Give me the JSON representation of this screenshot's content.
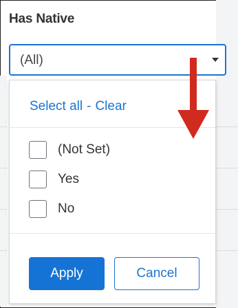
{
  "filter": {
    "title": "Has Native",
    "selected_value": "(All)"
  },
  "dropdown": {
    "select_all_label": "Select all",
    "separator": "-",
    "clear_label": "Clear",
    "options": [
      {
        "label": "(Not Set)",
        "checked": false
      },
      {
        "label": "Yes",
        "checked": false
      },
      {
        "label": "No",
        "checked": false
      }
    ],
    "apply_label": "Apply",
    "cancel_label": "Cancel"
  },
  "annotation": {
    "arrow_direction": "down",
    "arrow_color": "#d12a1e"
  },
  "colors": {
    "accent": "#1b74d1",
    "apply_button": "#1673d6",
    "text": "#333333"
  },
  "icons": {
    "select_chevron": "chevron-down-icon",
    "annotation": "arrow-down-icon"
  }
}
